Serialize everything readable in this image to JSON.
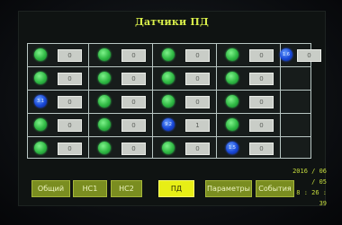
{
  "screen": {
    "title": "Датчики ПД"
  },
  "rows": [
    [
      {
        "ind": "green",
        "label": "",
        "value": "0"
      },
      {
        "ind": "green",
        "label": "",
        "value": "0"
      },
      {
        "ind": "green",
        "label": "",
        "value": "0"
      },
      {
        "ind": "green",
        "label": "",
        "value": "0"
      },
      {
        "ind": "blue",
        "label": "1.6",
        "value": "0"
      }
    ],
    [
      {
        "ind": "green",
        "label": "",
        "value": "0"
      },
      {
        "ind": "green",
        "label": "",
        "value": "0"
      },
      {
        "ind": "green",
        "label": "",
        "value": "0"
      },
      {
        "ind": "green",
        "label": "",
        "value": "0"
      }
    ],
    [
      {
        "ind": "blue",
        "label": "3.1",
        "value": "0"
      },
      {
        "ind": "green",
        "label": "",
        "value": "0"
      },
      {
        "ind": "green",
        "label": "",
        "value": "0"
      },
      {
        "ind": "green",
        "label": "",
        "value": "0"
      }
    ],
    [
      {
        "ind": "green",
        "label": "",
        "value": "0"
      },
      {
        "ind": "green",
        "label": "",
        "value": "0"
      },
      {
        "ind": "blue",
        "label": "9.2",
        "value": "1"
      },
      {
        "ind": "green",
        "label": "",
        "value": "0"
      }
    ],
    [
      {
        "ind": "green",
        "label": "",
        "value": "0"
      },
      {
        "ind": "green",
        "label": "",
        "value": "0"
      },
      {
        "ind": "green",
        "label": "",
        "value": "0"
      },
      {
        "ind": "blue",
        "label": "1.5",
        "value": "0"
      }
    ]
  ],
  "tabs": [
    {
      "label": "Общий",
      "active": false
    },
    {
      "label": "НС1",
      "active": false
    },
    {
      "label": "НС2",
      "active": false
    },
    {
      "label": "ПД",
      "active": true
    },
    {
      "label": "Параметры",
      "active": false
    },
    {
      "label": "События",
      "active": false
    }
  ],
  "datetime": {
    "date": "2016 / 06 / 05",
    "time": "8 : 26 : 39"
  },
  "colors": {
    "accent": "#e7ee16",
    "tab": "#7a8d20",
    "title": "#d9ef4a",
    "indicator_on": "#2fb843",
    "indicator_alt": "#1848d8"
  }
}
